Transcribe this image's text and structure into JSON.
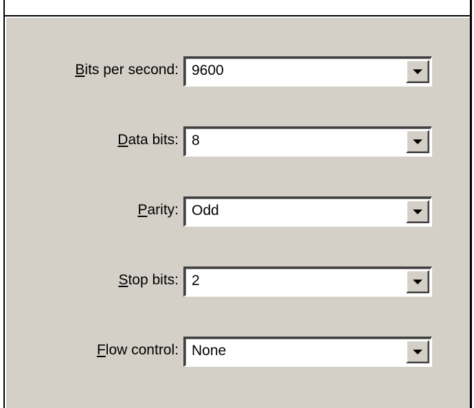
{
  "settings": [
    {
      "id": "bits",
      "label_access": "B",
      "label_rest": "its per second:",
      "value": "9600"
    },
    {
      "id": "data",
      "label_access": "D",
      "label_rest": "ata bits:",
      "value": "8"
    },
    {
      "id": "parity",
      "label_access": "P",
      "label_rest": "arity:",
      "value": "Odd"
    },
    {
      "id": "stop",
      "label_access": "S",
      "label_rest": "top bits:",
      "value": "2"
    },
    {
      "id": "flow",
      "label_access": "F",
      "label_rest": "low control:",
      "value": "None"
    }
  ],
  "icons": {
    "dropdown": "chevron-down-icon"
  }
}
